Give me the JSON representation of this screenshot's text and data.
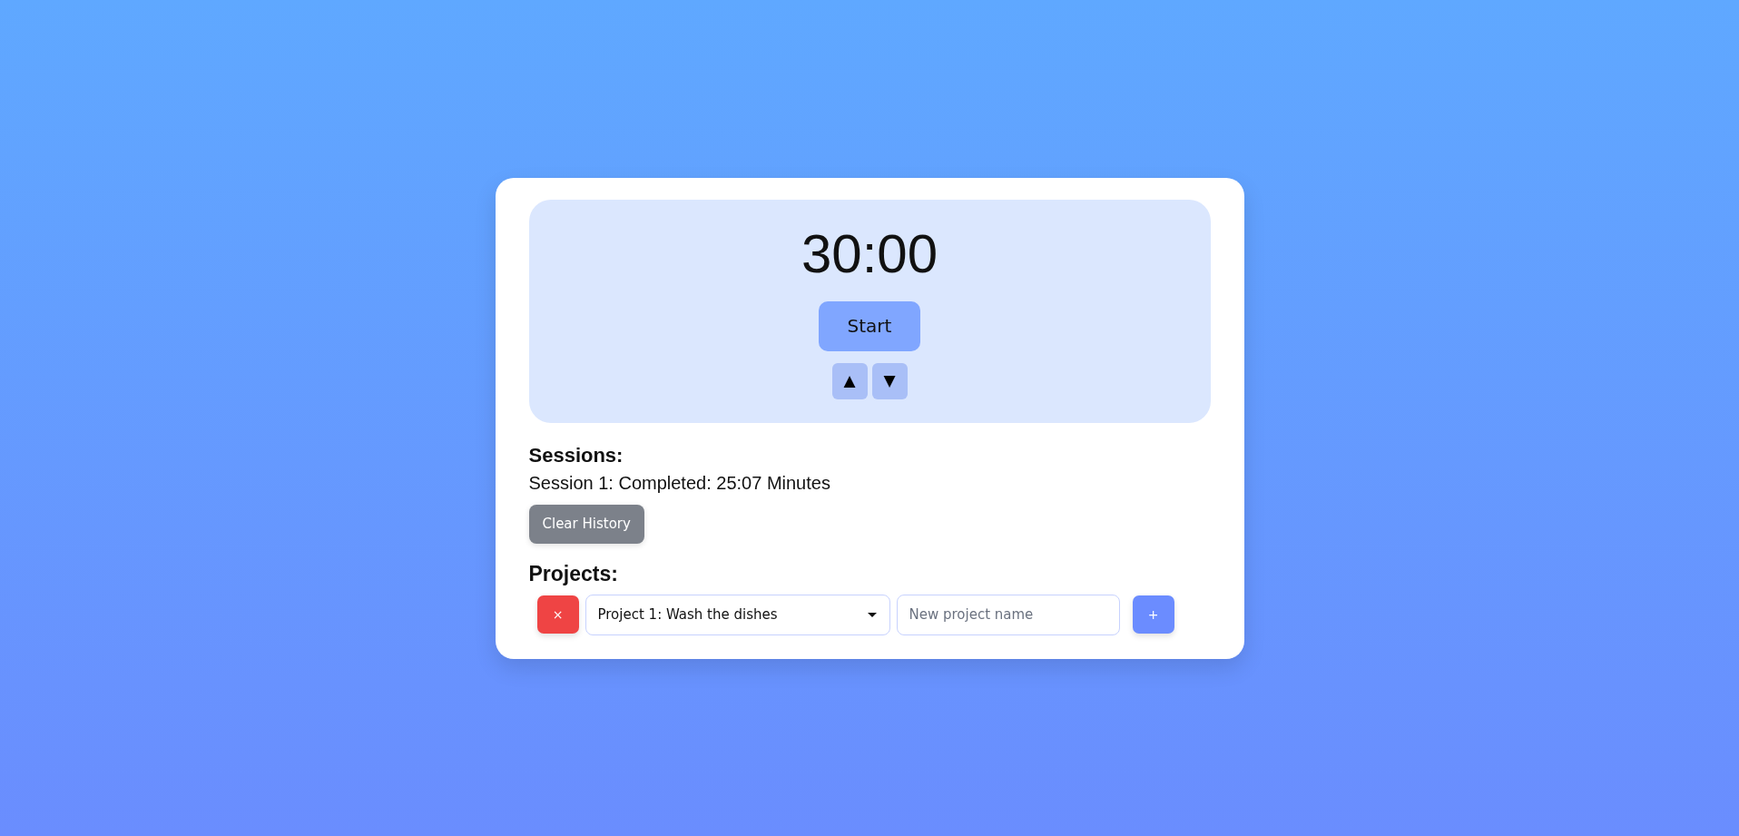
{
  "timer": {
    "time": "30:00",
    "start_button": "Start",
    "adjust_buttons": [
      {
        "label": "▲"
      },
      {
        "label": "▼"
      }
    ]
  },
  "sessions": {
    "heading": "Sessions:",
    "entries": [
      "Session 1: Completed: 25:07 Minutes"
    ],
    "clear_button": "Clear History"
  },
  "projects": {
    "heading": "Projects:",
    "delete_button": "×",
    "select": {
      "value": "Project 1: Wash the dishes"
    },
    "new_project": {
      "placeholder": "New project name"
    },
    "add_button": "+"
  }
}
